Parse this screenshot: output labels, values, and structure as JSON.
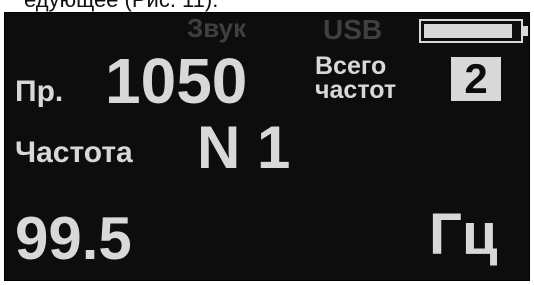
{
  "caption": "едующее (Рис. 11).",
  "status_bar": {
    "sound_label": "Звук",
    "usb_label": "USB",
    "battery_level": 0.94
  },
  "program": {
    "label": "Пр.",
    "value": "1050"
  },
  "total_frequencies": {
    "label_line1": "Всего",
    "label_line2": "частот",
    "value": "2"
  },
  "frequency": {
    "label": "Частота",
    "number": "N 1",
    "value": "99.5",
    "unit": "Гц"
  },
  "colors": {
    "screen_bg": "#0d0d0d",
    "bright_text": "#d8d8d8",
    "dim_text": "#3f3f3f"
  }
}
